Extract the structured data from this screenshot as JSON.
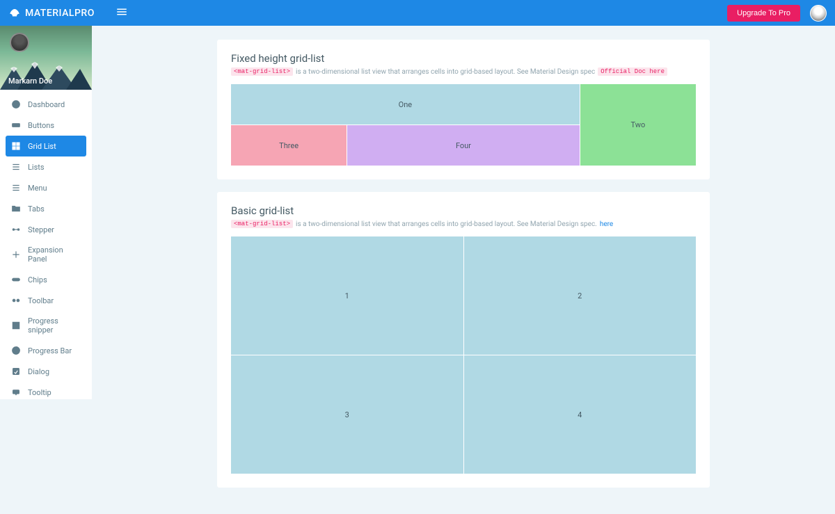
{
  "header": {
    "brand": "MATERIALPRO",
    "upgrade_label": "Upgrade To Pro"
  },
  "user": {
    "name": "Markarn Doe"
  },
  "sidebar": {
    "items": [
      {
        "label": "Dashboard",
        "icon": "speedometer"
      },
      {
        "label": "Buttons",
        "icon": "rectangle"
      },
      {
        "label": "Grid List",
        "icon": "grid",
        "active": true
      },
      {
        "label": "Lists",
        "icon": "list"
      },
      {
        "label": "Menu",
        "icon": "menu"
      },
      {
        "label": "Tabs",
        "icon": "folder"
      },
      {
        "label": "Stepper",
        "icon": "stepper"
      },
      {
        "label": "Expansion Panel",
        "icon": "expand"
      },
      {
        "label": "Chips",
        "icon": "chip"
      },
      {
        "label": "Toolbar",
        "icon": "toolbar"
      },
      {
        "label": "Progress snipper",
        "icon": "spinner"
      },
      {
        "label": "Progress Bar",
        "icon": "progress"
      },
      {
        "label": "Dialog",
        "icon": "dialog"
      },
      {
        "label": "Tooltip",
        "icon": "tooltip"
      }
    ]
  },
  "card1": {
    "title": "Fixed height grid-list",
    "code": "<mat-grid-list>",
    "desc": "is a two-dimensional list view that arranges cells into grid-based layout. See Material Design spec",
    "doc_chip": "Official Doc here",
    "tiles": [
      "One",
      "Two",
      "Three",
      "Four"
    ]
  },
  "card2": {
    "title": "Basic grid-list",
    "code": "<mat-grid-list>",
    "desc": "is a two-dimensional list view that arranges cells into grid-based layout. See Material Design spec.",
    "link": "here",
    "tiles": [
      "1",
      "2",
      "3",
      "4"
    ]
  }
}
